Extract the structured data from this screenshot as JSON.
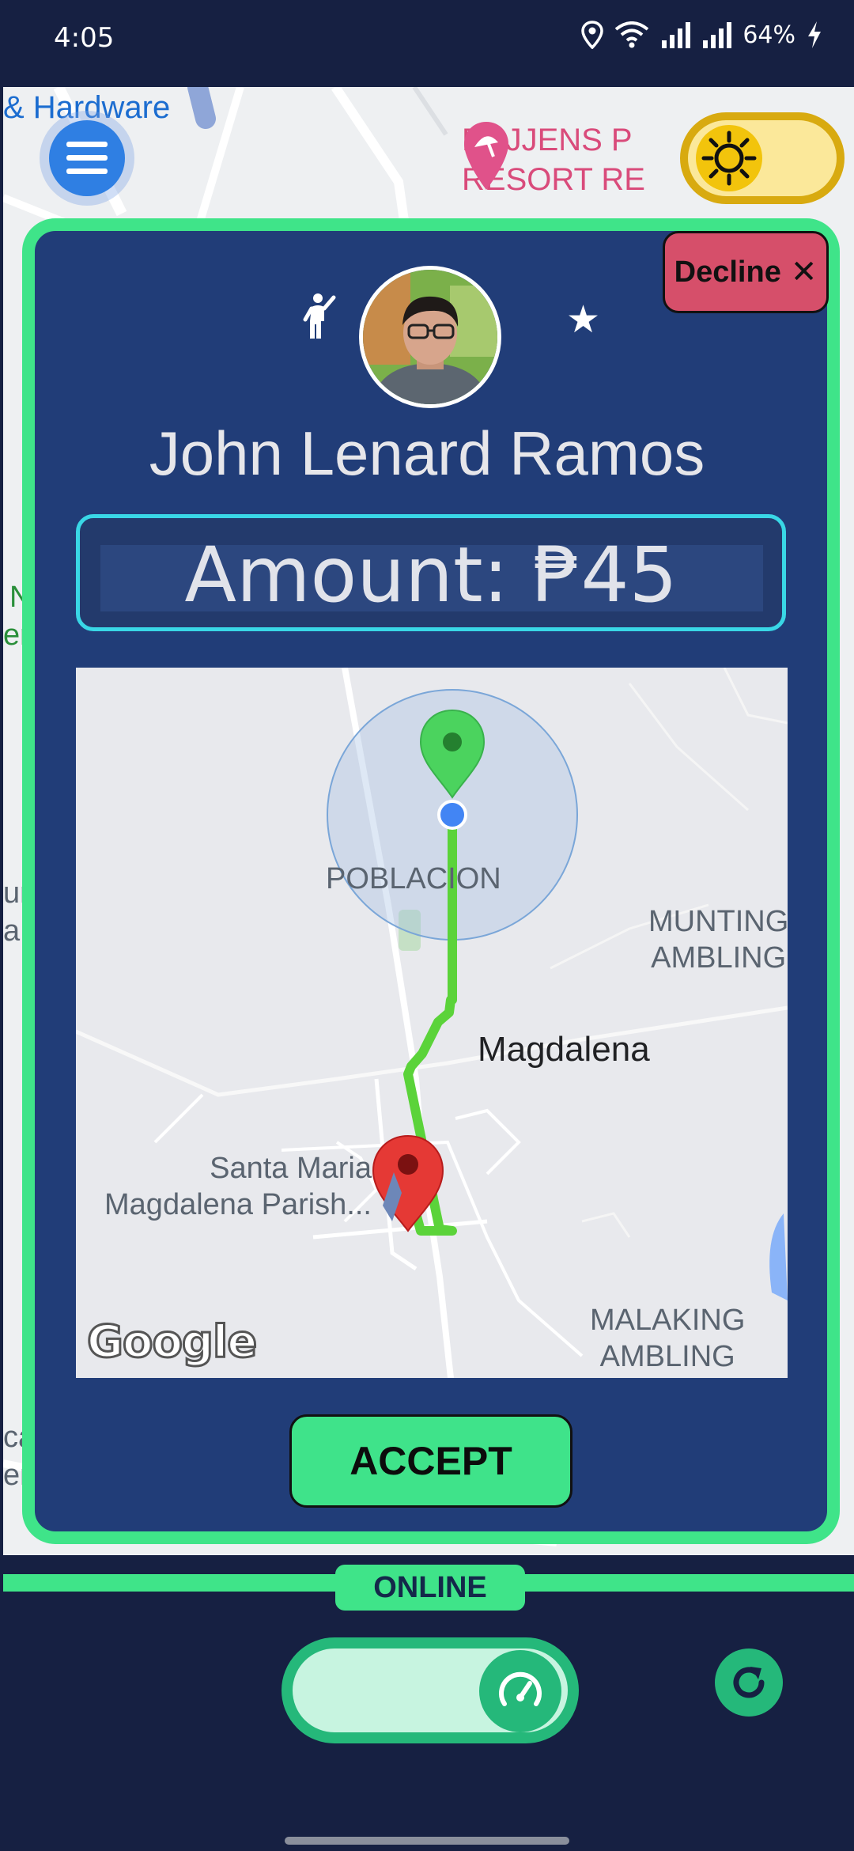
{
  "status_bar": {
    "time": "4:05",
    "battery": "64%",
    "icons": [
      "location-icon",
      "wifi-icon",
      "signal-icon",
      "signal-icon",
      "charging-icon"
    ]
  },
  "background_map": {
    "hardware_label": "& Hardware",
    "resort_label_line1": "RAJJENS P",
    "resort_label_line2": "RESORT RE",
    "fragments": [
      "N",
      "en",
      "un",
      "a",
      "ca",
      "er"
    ]
  },
  "ride_request": {
    "decline_label": "Decline",
    "decline_icon": "close-icon",
    "passenger_name": "John Lenard Ramos",
    "amount_text": "Amount: ₱45",
    "map": {
      "labels": {
        "poblacion": "POBLACION",
        "munting_line1": "MUNTING",
        "munting_line2": "AMBLING",
        "magdalena": "Magdalena",
        "parish_line1": "Santa Maria",
        "parish_line2": "Magdalena Parish...",
        "malaking_line1": "MALAKING",
        "malaking_line2": "AMBLING"
      },
      "google_logo": "Google",
      "colors": {
        "route": "#5bd33a",
        "pickup_pin": "#4bd35e",
        "dropoff_pin": "#e53935"
      }
    },
    "accept_label": "ACCEPT"
  },
  "driver_status": {
    "online_label": "ONLINE",
    "toggle_icon": "speedometer-icon",
    "refresh_icon": "refresh-icon"
  },
  "colors": {
    "background": "#162042",
    "card": "#213d78",
    "accent_green": "#3fe489",
    "decline_red": "#d64f6a",
    "amount_border": "#39d7e6"
  }
}
